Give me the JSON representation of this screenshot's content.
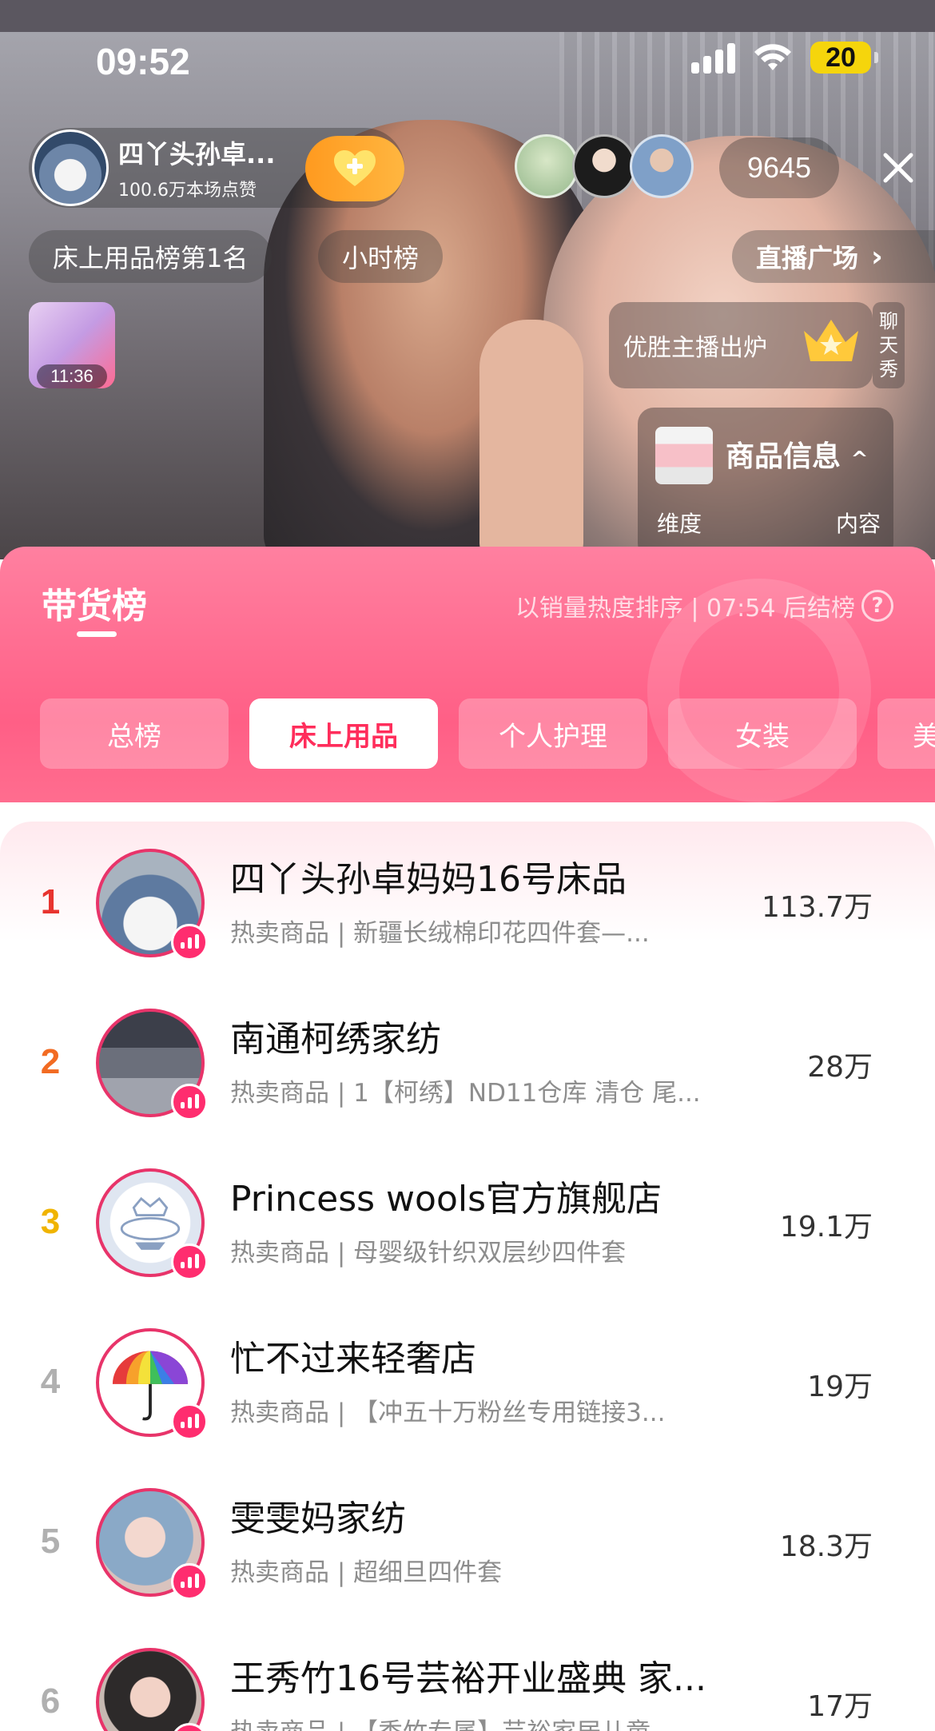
{
  "status_bar": {
    "time": "09:52",
    "battery": "20"
  },
  "host": {
    "name": "四丫头孙卓...",
    "likes": "100.6万本场点赞",
    "viewer_count": "9645"
  },
  "chips": {
    "rank": "床上用品榜第1名",
    "hourly": "小时榜",
    "plaza": "直播广场"
  },
  "widgets": {
    "gift_timer": "11:36",
    "winner_banner": "优胜主播出炉",
    "chat_show": [
      "聊",
      "天",
      "秀"
    ],
    "product_card": {
      "title": "商品信息",
      "left_label": "维度",
      "right_label": "内容"
    }
  },
  "panel": {
    "title": "带货榜",
    "subtitle": "以销量热度排序 | 07:54 后结榜",
    "tabs": [
      {
        "label": "总榜",
        "active": false
      },
      {
        "label": "床上用品",
        "active": true
      },
      {
        "label": "个人护理",
        "active": false
      },
      {
        "label": "女装",
        "active": false
      },
      {
        "label": "美",
        "active": false
      }
    ]
  },
  "rank_colors": {
    "1": "#e8342f",
    "2": "#f26b22",
    "3": "#f0b400",
    "other": "#b0b0b0"
  },
  "rankings": [
    {
      "rank": "1",
      "name": "四丫头孙卓妈妈16号床品",
      "sub": "热卖商品 | 新疆长绒棉印花四件套—...",
      "value": "113.7万"
    },
    {
      "rank": "2",
      "name": "南通柯绣家纺",
      "sub": "热卖商品 | 1【柯绣】ND11仓库 清仓 尾...",
      "value": "28万"
    },
    {
      "rank": "3",
      "name": "Princess wools官方旗舰店",
      "sub": "热卖商品 | 母婴级针织双层纱四件套",
      "value": "19.1万"
    },
    {
      "rank": "4",
      "name": "忙不过来轻奢店",
      "sub": "热卖商品 | 【冲五十万粉丝专用链接3...",
      "value": "19万"
    },
    {
      "rank": "5",
      "name": "雯雯妈家纺",
      "sub": "热卖商品 | 超细旦四件套",
      "value": "18.3万"
    },
    {
      "rank": "6",
      "name": "王秀竹16号芸裕开业盛典 家...",
      "sub": "热卖商品 | 【秀竹专属】芸裕家居儿童...",
      "value": "17万"
    }
  ]
}
